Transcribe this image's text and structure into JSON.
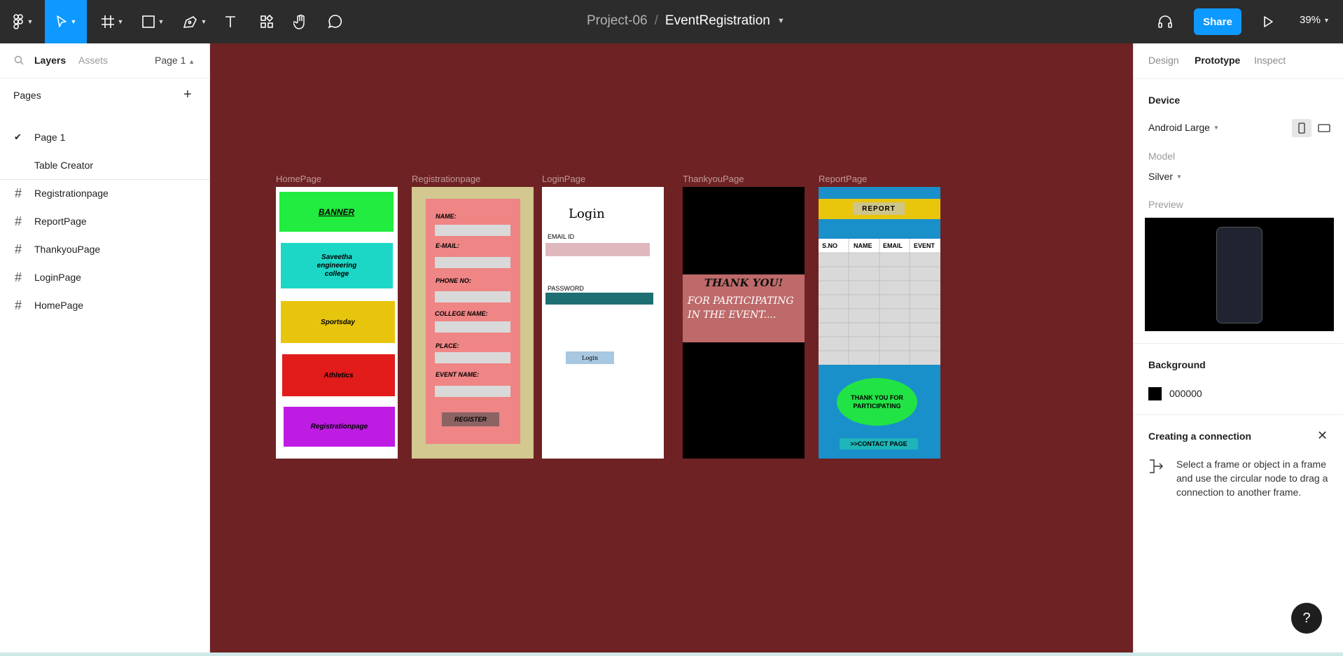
{
  "toolbar": {
    "project": "Project-06",
    "separator": "/",
    "file_name": "EventRegistration",
    "share_label": "Share",
    "zoom": "39%"
  },
  "left_panel": {
    "tabs": {
      "layers": "Layers",
      "assets": "Assets",
      "page_selector": "Page 1"
    },
    "pages_header": "Pages",
    "pages": [
      {
        "label": "Page 1",
        "selected": true
      },
      {
        "label": "Table Creator",
        "selected": false
      }
    ],
    "layers": [
      "Registrationpage",
      "ReportPage",
      "ThankyouPage",
      "LoginPage",
      "HomePage"
    ]
  },
  "canvas": {
    "background": "#6e2223",
    "frames": {
      "home": {
        "label": "HomePage",
        "boxes": [
          "BANNER",
          "Saveetha engineering college",
          "Sportsday",
          "Athletics",
          "Registrationpage"
        ]
      },
      "registration": {
        "label": "Registrationpage",
        "fields": [
          "NAME:",
          "E-MAIL:",
          "PHONE NO:",
          "COLLEGE NAME:",
          "PLACE:",
          "EVENT NAME:"
        ],
        "button": "REGISTER"
      },
      "login": {
        "label": "LoginPage",
        "title": "Login",
        "email_label": "EMAIL ID",
        "password_label": "PASSWORD",
        "button": "Login"
      },
      "thankyou": {
        "label": "ThankyouPage",
        "line1": "THANK YOU!",
        "line2": "FOR PARTICIPATING IN THE EVENT...."
      },
      "report": {
        "label": "ReportPage",
        "header_button": "REPORT",
        "columns": [
          "S.NO",
          "NAME",
          "EMAIL",
          "EVENT"
        ],
        "bubble": "THANK YOU FOR PARTICIPATING",
        "contact": ">>CONTACT PAGE"
      }
    }
  },
  "right_panel": {
    "tabs": {
      "design": "Design",
      "prototype": "Prototype",
      "inspect": "Inspect"
    },
    "device_header": "Device",
    "device_value": "Android Large",
    "model_label": "Model",
    "model_value": "Silver",
    "preview_label": "Preview",
    "background_header": "Background",
    "background_value": "000000",
    "background_color": "#000000",
    "connection_header": "Creating a connection",
    "connection_text": "Select a frame or object in a frame and use the circular node to drag a connection to another frame.",
    "help": "?"
  },
  "icons": {
    "toolbar": [
      "figma-menu-icon",
      "move-icon",
      "frame-icon",
      "rectangle-icon",
      "pen-icon",
      "text-icon",
      "resources-icon",
      "hand-icon",
      "comment-icon",
      "headphones-icon",
      "play-icon"
    ]
  }
}
